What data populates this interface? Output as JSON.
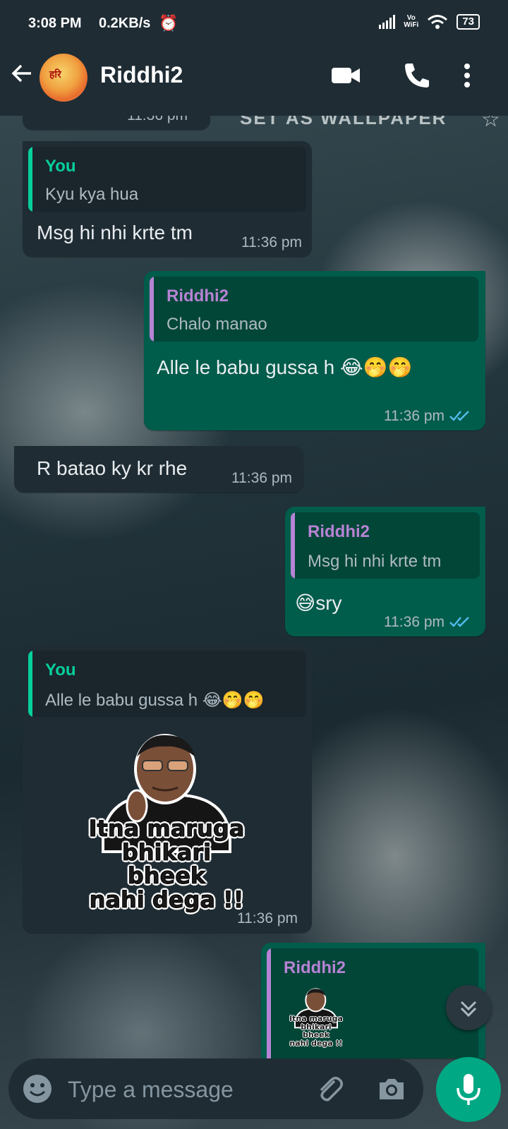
{
  "status_bar": {
    "time": "3:08 PM",
    "network_speed": "0.2KB/s",
    "vowifi_line1": "Vo",
    "vowifi_line2": "WiFi",
    "battery": "73"
  },
  "header": {
    "contact_name": "Riddhi2",
    "avatar_text": "हरि"
  },
  "wallpaper": {
    "overlay_text": "SET AS WALLPAPER",
    "partial_timestamp": "11:36 pm"
  },
  "messages": [
    {
      "direction": "incoming",
      "quote": {
        "author": "You",
        "text": "Kyu kya hua"
      },
      "text": "Msg hi nhi krte tm",
      "time": "11:36 pm"
    },
    {
      "direction": "outgoing",
      "quote": {
        "author": "Riddhi2",
        "text": "Chalo manao"
      },
      "text": "Alle le babu gussa h 😂🤭🤭",
      "time": "11:36 pm",
      "read": true
    },
    {
      "direction": "incoming",
      "text": "R batao ky kr rhe",
      "time": "11:36 pm"
    },
    {
      "direction": "outgoing",
      "quote": {
        "author": "Riddhi2",
        "text": "Msg hi nhi krte tm"
      },
      "text": "😅sry",
      "time": "11:36 pm",
      "read": true
    },
    {
      "direction": "incoming",
      "quote": {
        "author": "You",
        "text": "Alle le babu gussa h 😂🤭🤭"
      },
      "sticker_text": "Itna maruga bhikari bheek nahi dega !!",
      "sticker_lines": [
        "Itna maruga",
        "bhikari bheek",
        "nahi dega !!"
      ],
      "time": "11:36 pm"
    },
    {
      "direction": "outgoing",
      "quote": {
        "author": "Riddhi2",
        "sticker_lines": [
          "Itna maruga",
          "bhikari bheek",
          "nahi dega !!"
        ]
      }
    }
  ],
  "composer": {
    "placeholder": "Type a message"
  },
  "colors": {
    "header_bg": "#1f2c34",
    "incoming_bubble": "#1f2c34",
    "outgoing_bubble": "#005c4b",
    "accent_green": "#00a884",
    "quote_author_you": "#06cf9c",
    "quote_author_contact": "#b783d4",
    "read_ticks": "#53bdeb"
  },
  "icons": [
    "back-arrow-icon",
    "video-call-icon",
    "voice-call-icon",
    "more-options-icon",
    "emoji-icon",
    "attach-icon",
    "camera-icon",
    "mic-icon",
    "scroll-down-icon",
    "double-tick-icon",
    "alarm-icon",
    "signal-icon",
    "wifi-icon",
    "star-icon"
  ]
}
